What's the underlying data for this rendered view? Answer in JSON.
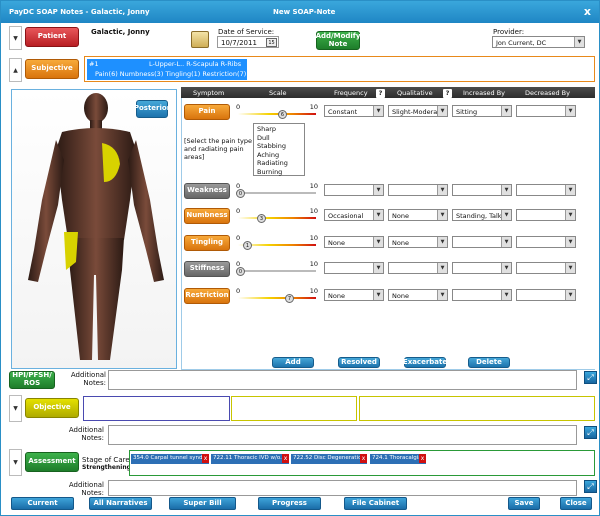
{
  "window": {
    "title": "PayDC SOAP Notes - Galactic, Jonny",
    "center_title": "New SOAP-Note",
    "close": "x"
  },
  "patient": {
    "button": "Patient",
    "name": "Galactic, Jonny",
    "dos_label": "Date of Service:",
    "dos_value": "10/7/2011",
    "cal_day": "15",
    "add_note": "Add/Modify Note",
    "provider_label": "Provider:",
    "provider_value": "Jon Current, DC"
  },
  "subjective": {
    "button": "Subjective",
    "list": [
      "#1",
      "L-Upper-L.. R-Scapula R-Ribs",
      "Pain(6) Numbness(3) Tingling(1) Restriction(7)"
    ]
  },
  "body": {
    "view_button": "Posterior"
  },
  "table_header": {
    "symptom": "Symptom",
    "scale": "Scale",
    "frequency": "Frequency",
    "qualitative": "Qualitative",
    "increased": "Increased By",
    "decreased": "Decreased By",
    "help": "?"
  },
  "symptoms": [
    {
      "name": "Pain",
      "color": "orange",
      "value": 6,
      "frequency": "Constant",
      "qualitative": "Slight-Moderate",
      "increased": "Sitting",
      "decreased": ""
    },
    {
      "name": "Weakness",
      "color": "grey",
      "value": 0,
      "frequency": "",
      "qualitative": "",
      "increased": "",
      "decreased": ""
    },
    {
      "name": "Numbness",
      "color": "orange",
      "value": 3,
      "frequency": "Occasional",
      "qualitative": "None",
      "increased": "Standing, Talking",
      "decreased": ""
    },
    {
      "name": "Tingling",
      "color": "orange",
      "value": 1,
      "frequency": "None",
      "qualitative": "None",
      "increased": "",
      "decreased": ""
    },
    {
      "name": "Stiffness",
      "color": "grey",
      "value": 0,
      "frequency": "",
      "qualitative": "",
      "increased": "",
      "decreased": ""
    },
    {
      "name": "Restriction",
      "color": "orange",
      "value": 7,
      "frequency": "None",
      "qualitative": "None",
      "increased": "",
      "decreased": ""
    }
  ],
  "scale": {
    "min": "0",
    "max": "10"
  },
  "pain_type": {
    "prompt": "[Select the pain type and radiating pain areas]",
    "options": [
      "Sharp",
      "Dull",
      "Stabbing",
      "Aching",
      "Radiating",
      "Burning"
    ]
  },
  "actions": {
    "add": "Add",
    "resolved": "Resolved",
    "exacerbate": "Exacerbate",
    "delete": "Delete"
  },
  "hpi": {
    "button": "HPI/PFSH/ ROS",
    "notes_label": "Additional Notes:"
  },
  "objective": {
    "button": "Objective",
    "notes_label": "Additional Notes:"
  },
  "assessment": {
    "button": "Assessment",
    "stage_label": "Stage of Care:",
    "stage_value": "Strengthening",
    "tags": [
      "354.0 Carpal tunnel synd...",
      "722.11 Thoracic IVD w/o...",
      "722.52 Disc Degeneration",
      "724.1 Thoracalgia"
    ],
    "notes_label": "Additional Notes:"
  },
  "bottom": {
    "current": "Current Narrative",
    "all": "All Narratives",
    "superbill": "Super Bill Report",
    "progress": "Progress Graph",
    "cabinet": "File Cabinet",
    "save": "Save",
    "close": "Close"
  },
  "colors": {
    "accent": "#1f86c4",
    "patient": "#c4262b",
    "subjective": "#e8891a",
    "objective": "#c7c400",
    "assessment": "#2a9a38",
    "highlight": "#1e90ff"
  }
}
